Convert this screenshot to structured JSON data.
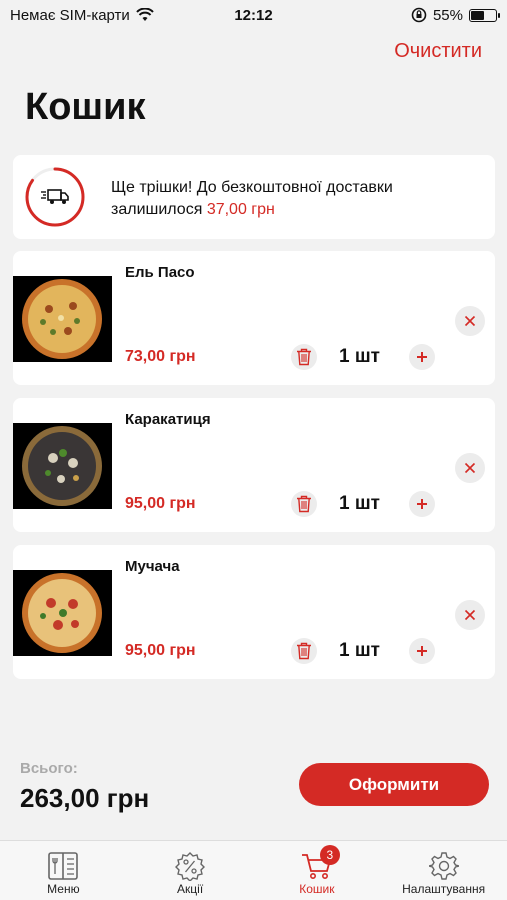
{
  "status_bar": {
    "carrier": "Немає SIM-карти",
    "time": "12:12",
    "battery": "55%",
    "battery_level": 0.55
  },
  "header": {
    "clear_label": "Очистити",
    "title": "Кошик"
  },
  "delivery": {
    "message": "Ще трішки! До безкоштовної доставки залишилося",
    "amount": "37,00 грн",
    "progress": 0.85
  },
  "items": [
    {
      "name": "Ель Пасо",
      "price": "73,00 грн",
      "quantity": "1 шт"
    },
    {
      "name": "Каракатиця",
      "price": "95,00 грн",
      "quantity": "1 шт"
    },
    {
      "name": "Мучача",
      "price": "95,00 грн",
      "quantity": "1 шт"
    }
  ],
  "summary": {
    "total_label": "Всього:",
    "total_value": "263,00 грн",
    "checkout_label": "Оформити"
  },
  "tabs": [
    {
      "label": "Меню",
      "icon": "menu-book-icon"
    },
    {
      "label": "Акції",
      "icon": "discount-icon"
    },
    {
      "label": "Кошик",
      "icon": "cart-icon",
      "badge": "3",
      "active": true
    },
    {
      "label": "Налаштування",
      "icon": "gear-icon"
    }
  ],
  "colors": {
    "accent": "#d42a25",
    "background": "#f2f2f2"
  }
}
